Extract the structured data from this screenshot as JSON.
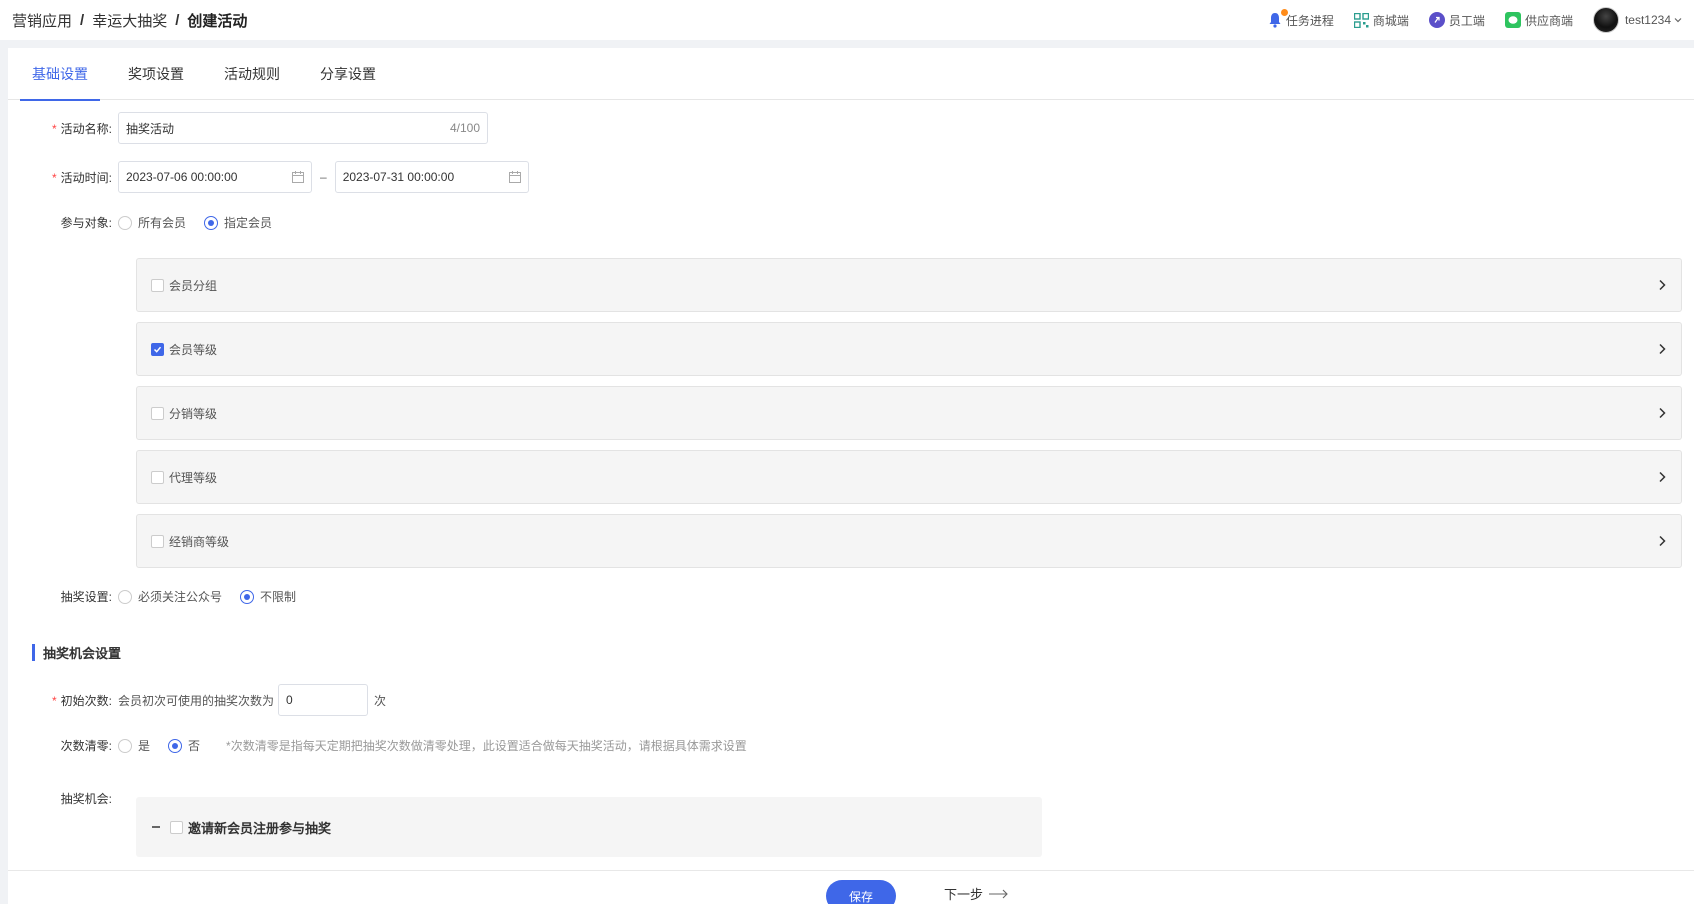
{
  "breadcrumb": [
    "营销应用",
    "幸运大抽奖",
    "创建活动"
  ],
  "breadcrumb_sep": "/",
  "header": {
    "task_progress": "任务进程",
    "mall": "商城端",
    "staff": "员工端",
    "supplier": "供应商端",
    "username": "test1234"
  },
  "tabs": [
    "基础设置",
    "奖项设置",
    "活动规则",
    "分享设置"
  ],
  "form": {
    "name": {
      "label": "活动名称:",
      "value": "抽奖活动",
      "count": "4/100"
    },
    "time": {
      "label": "活动时间:",
      "start": "2023-07-06 00:00:00",
      "end": "2023-07-31 00:00:00",
      "sep": "–"
    },
    "target": {
      "label": "参与对象:",
      "options": [
        "所有会员",
        "指定会员"
      ],
      "selected": "指定会员"
    },
    "member_panels": [
      {
        "label": "会员分组",
        "checked": false
      },
      {
        "label": "会员等级",
        "checked": true
      },
      {
        "label": "分销等级",
        "checked": false
      },
      {
        "label": "代理等级",
        "checked": false
      },
      {
        "label": "经销商等级",
        "checked": false
      }
    ],
    "draw_setting": {
      "label": "抽奖设置:",
      "options": [
        "必须关注公众号",
        "不限制"
      ],
      "selected": "不限制"
    }
  },
  "section": {
    "title": "抽奖机会设置"
  },
  "chance": {
    "initial": {
      "label": "初始次数:",
      "prefix": "会员初次可使用的抽奖次数为",
      "value": "0",
      "unit": "次"
    },
    "reset": {
      "label": "次数清零:",
      "options": [
        "是",
        "否"
      ],
      "selected": "否",
      "hint": "*次数清零是指每天定期把抽奖次数做清零处理，此设置适合做每天抽奖活动，请根据具体需求设置"
    },
    "opportunity": {
      "label": "抽奖机会:",
      "item": "邀请新会员注册参与抽奖"
    }
  },
  "footer": {
    "save": "保存",
    "next": "下一步"
  },
  "colors": {
    "accent": "#3f67e8",
    "required": "#ff4444",
    "bell_dot": "#ff8c1a"
  }
}
